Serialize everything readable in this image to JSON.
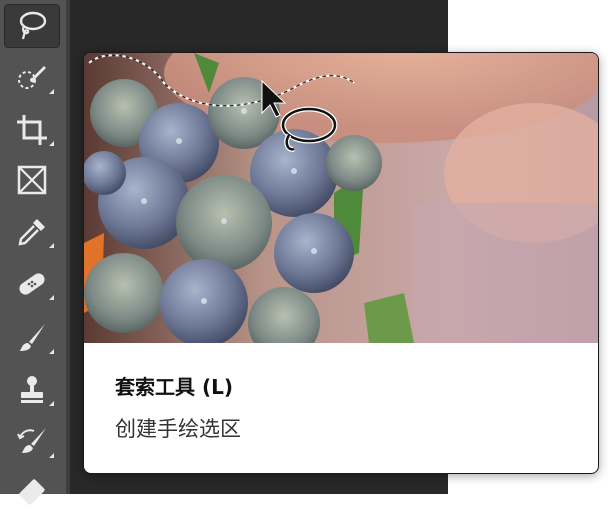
{
  "toolbar": {
    "tools": [
      {
        "icon": "lasso-icon",
        "active": true
      },
      {
        "icon": "quick-selection-icon"
      },
      {
        "icon": "crop-icon"
      },
      {
        "icon": "frame-icon"
      },
      {
        "icon": "eyedropper-icon"
      },
      {
        "icon": "healing-brush-icon"
      },
      {
        "icon": "brush-icon"
      },
      {
        "icon": "clone-stamp-icon"
      },
      {
        "icon": "history-brush-icon"
      },
      {
        "icon": "eraser-icon"
      }
    ]
  },
  "tooltip": {
    "title": "套索工具 (L)",
    "description": "创建手绘选区",
    "preview_image": "hydrangea-flowers-lasso-preview"
  },
  "colors": {
    "toolbar": "#535353",
    "canvas": "#282828",
    "tooltip_bg": "#ffffff"
  }
}
